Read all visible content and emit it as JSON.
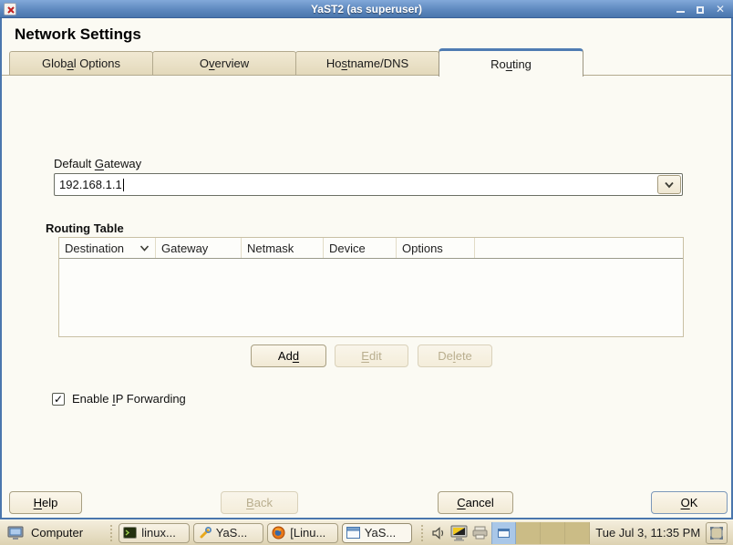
{
  "window": {
    "title": "YaST2 (as superuser)",
    "controls": {
      "close_glyph": "✕"
    }
  },
  "heading": "Network Settings",
  "tabs": [
    {
      "pre": "Glob",
      "key": "a",
      "post": "l Options",
      "active": false
    },
    {
      "pre": "O",
      "key": "v",
      "post": "erview",
      "active": false
    },
    {
      "pre": "Ho",
      "key": "s",
      "post": "tname/DNS",
      "active": false
    },
    {
      "pre": "Ro",
      "key": "u",
      "post": "ting",
      "active": true
    }
  ],
  "routing": {
    "default_gateway": {
      "label_pre": "Default ",
      "label_key": "G",
      "label_post": "ateway",
      "value": "192.168.1.1"
    },
    "table": {
      "title": "Routing Table",
      "columns": [
        "Destination",
        "Gateway",
        "Netmask",
        "Device",
        "Options"
      ],
      "rows": []
    },
    "buttons": {
      "add": {
        "pre": "Ad",
        "key": "d",
        "post": "",
        "enabled": true
      },
      "edit": {
        "pre": "",
        "key": "E",
        "post": "dit",
        "enabled": false
      },
      "delete": {
        "pre": "De",
        "key": "l",
        "post": "ete",
        "enabled": false
      }
    },
    "ip_forwarding": {
      "label_pre": "Enable ",
      "label_key": "I",
      "label_post": "P Forwarding",
      "checked": true,
      "check_glyph": "✓"
    }
  },
  "footer": {
    "help": {
      "pre": "",
      "key": "H",
      "post": "elp",
      "enabled": true
    },
    "back": {
      "pre": "",
      "key": "B",
      "post": "ack",
      "enabled": false
    },
    "cancel": {
      "pre": "",
      "key": "C",
      "post": "ancel",
      "enabled": true
    },
    "ok": {
      "pre": "",
      "key": "O",
      "post": "K",
      "enabled": true
    }
  },
  "taskbar": {
    "computer_label": "Computer",
    "tasks": [
      {
        "label": "linux...",
        "icon": "terminal-icon",
        "active": false
      },
      {
        "label": "YaS...",
        "icon": "yast-wrench-icon",
        "active": false
      },
      {
        "label": "[Linu...",
        "icon": "firefox-icon",
        "active": false
      },
      {
        "label": "YaS...",
        "icon": "window-icon",
        "active": true
      }
    ],
    "clock": "Tue Jul 3, 11:35 PM"
  },
  "colors": {
    "titlebar_blue": "#5e89bf",
    "frame_blue": "#4a76ad",
    "dialog_bg": "#fbfaf3",
    "tab_inactive_bg": "#e9dfc4",
    "active_tab_accent": "#4f7cb2",
    "taskbar_tan": "#ddd2b2",
    "pager_active": "#a9c7e8",
    "disabled_text": "#b9ae8e"
  }
}
